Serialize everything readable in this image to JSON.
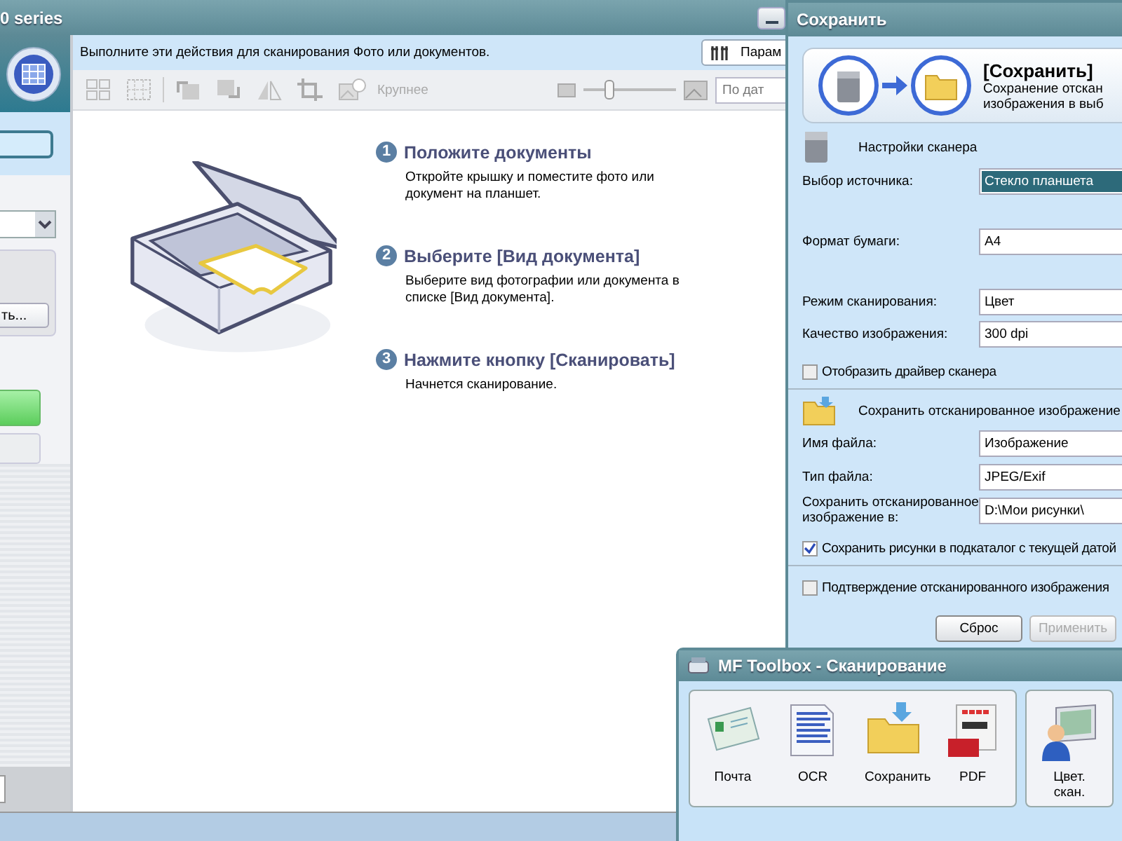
{
  "main_window": {
    "title": "0 series",
    "instruction": "Выполните эти действия для сканирования Фото или документов.",
    "settings_button": "Парам",
    "left_panel": {
      "browse_button": "ть..."
    },
    "toolbar": {
      "zoom_label": "Крупнее",
      "zoom_slider": {
        "level": 0.28
      },
      "sort_field": "По дат"
    },
    "steps": [
      {
        "number": "1",
        "title": "Положите документы",
        "text": "Откройте крышку и поместите фото или документ на планшет."
      },
      {
        "number": "2",
        "title": "Выберите [Вид документа]",
        "text": "Выберите вид фотографии или документа в списке [Вид документа]."
      },
      {
        "number": "3",
        "title": "Нажмите кнопку [Сканировать]",
        "text": "Начнется сканирование."
      }
    ]
  },
  "save_dialog": {
    "title": "Сохранить",
    "header": {
      "title": "[Сохранить]",
      "description": [
        "Сохранение отскан",
        "изображения в выб"
      ]
    },
    "scanner_section": {
      "title": "Настройки сканера",
      "fields": [
        {
          "label": "Выбор источника:",
          "value": "Стекло планшета",
          "highlighted": true
        },
        {
          "label": "Формат бумаги:",
          "value": "A4",
          "highlighted": false
        },
        {
          "label": "Режим сканирования:",
          "value": "Цвет",
          "highlighted": false
        },
        {
          "label": "Качество изображения:",
          "value": "300 dpi",
          "highlighted": false
        }
      ],
      "driver_checkbox": {
        "label": "Отобразить драйвер сканера",
        "checked": false
      }
    },
    "save_section": {
      "title": "Сохранить отсканированное изображение",
      "fields": [
        {
          "label": "Имя файла:",
          "value": "Изображение",
          "highlighted": false
        },
        {
          "label": "Тип файла:",
          "value": "JPEG/Exif",
          "highlighted": false
        },
        {
          "label": "Сохранить отсканированное изображение в:",
          "value": "D:\\Мои рисунки\\",
          "highlighted": false
        }
      ],
      "subfolder_checkbox": {
        "label": "Сохранить рисунки в подкаталог с текущей датой",
        "checked": true
      }
    },
    "confirm_checkbox": {
      "label": "Подтверждение отсканированного изображения",
      "checked": false
    },
    "buttons": [
      {
        "label": "Сброс",
        "disabled": false
      },
      {
        "label": "Применить",
        "disabled": true
      }
    ]
  },
  "toolbox": {
    "title": "MF Toolbox - Сканирование",
    "groups": [
      [
        {
          "label": "Почта",
          "kind": "mail"
        },
        {
          "label": "OCR",
          "kind": "ocr"
        },
        {
          "label": "Сохранить",
          "kind": "folder"
        },
        {
          "label": "PDF",
          "kind": "pdf"
        }
      ],
      [
        {
          "label": "Цвет. скан.",
          "kind": "person"
        }
      ]
    ]
  }
}
